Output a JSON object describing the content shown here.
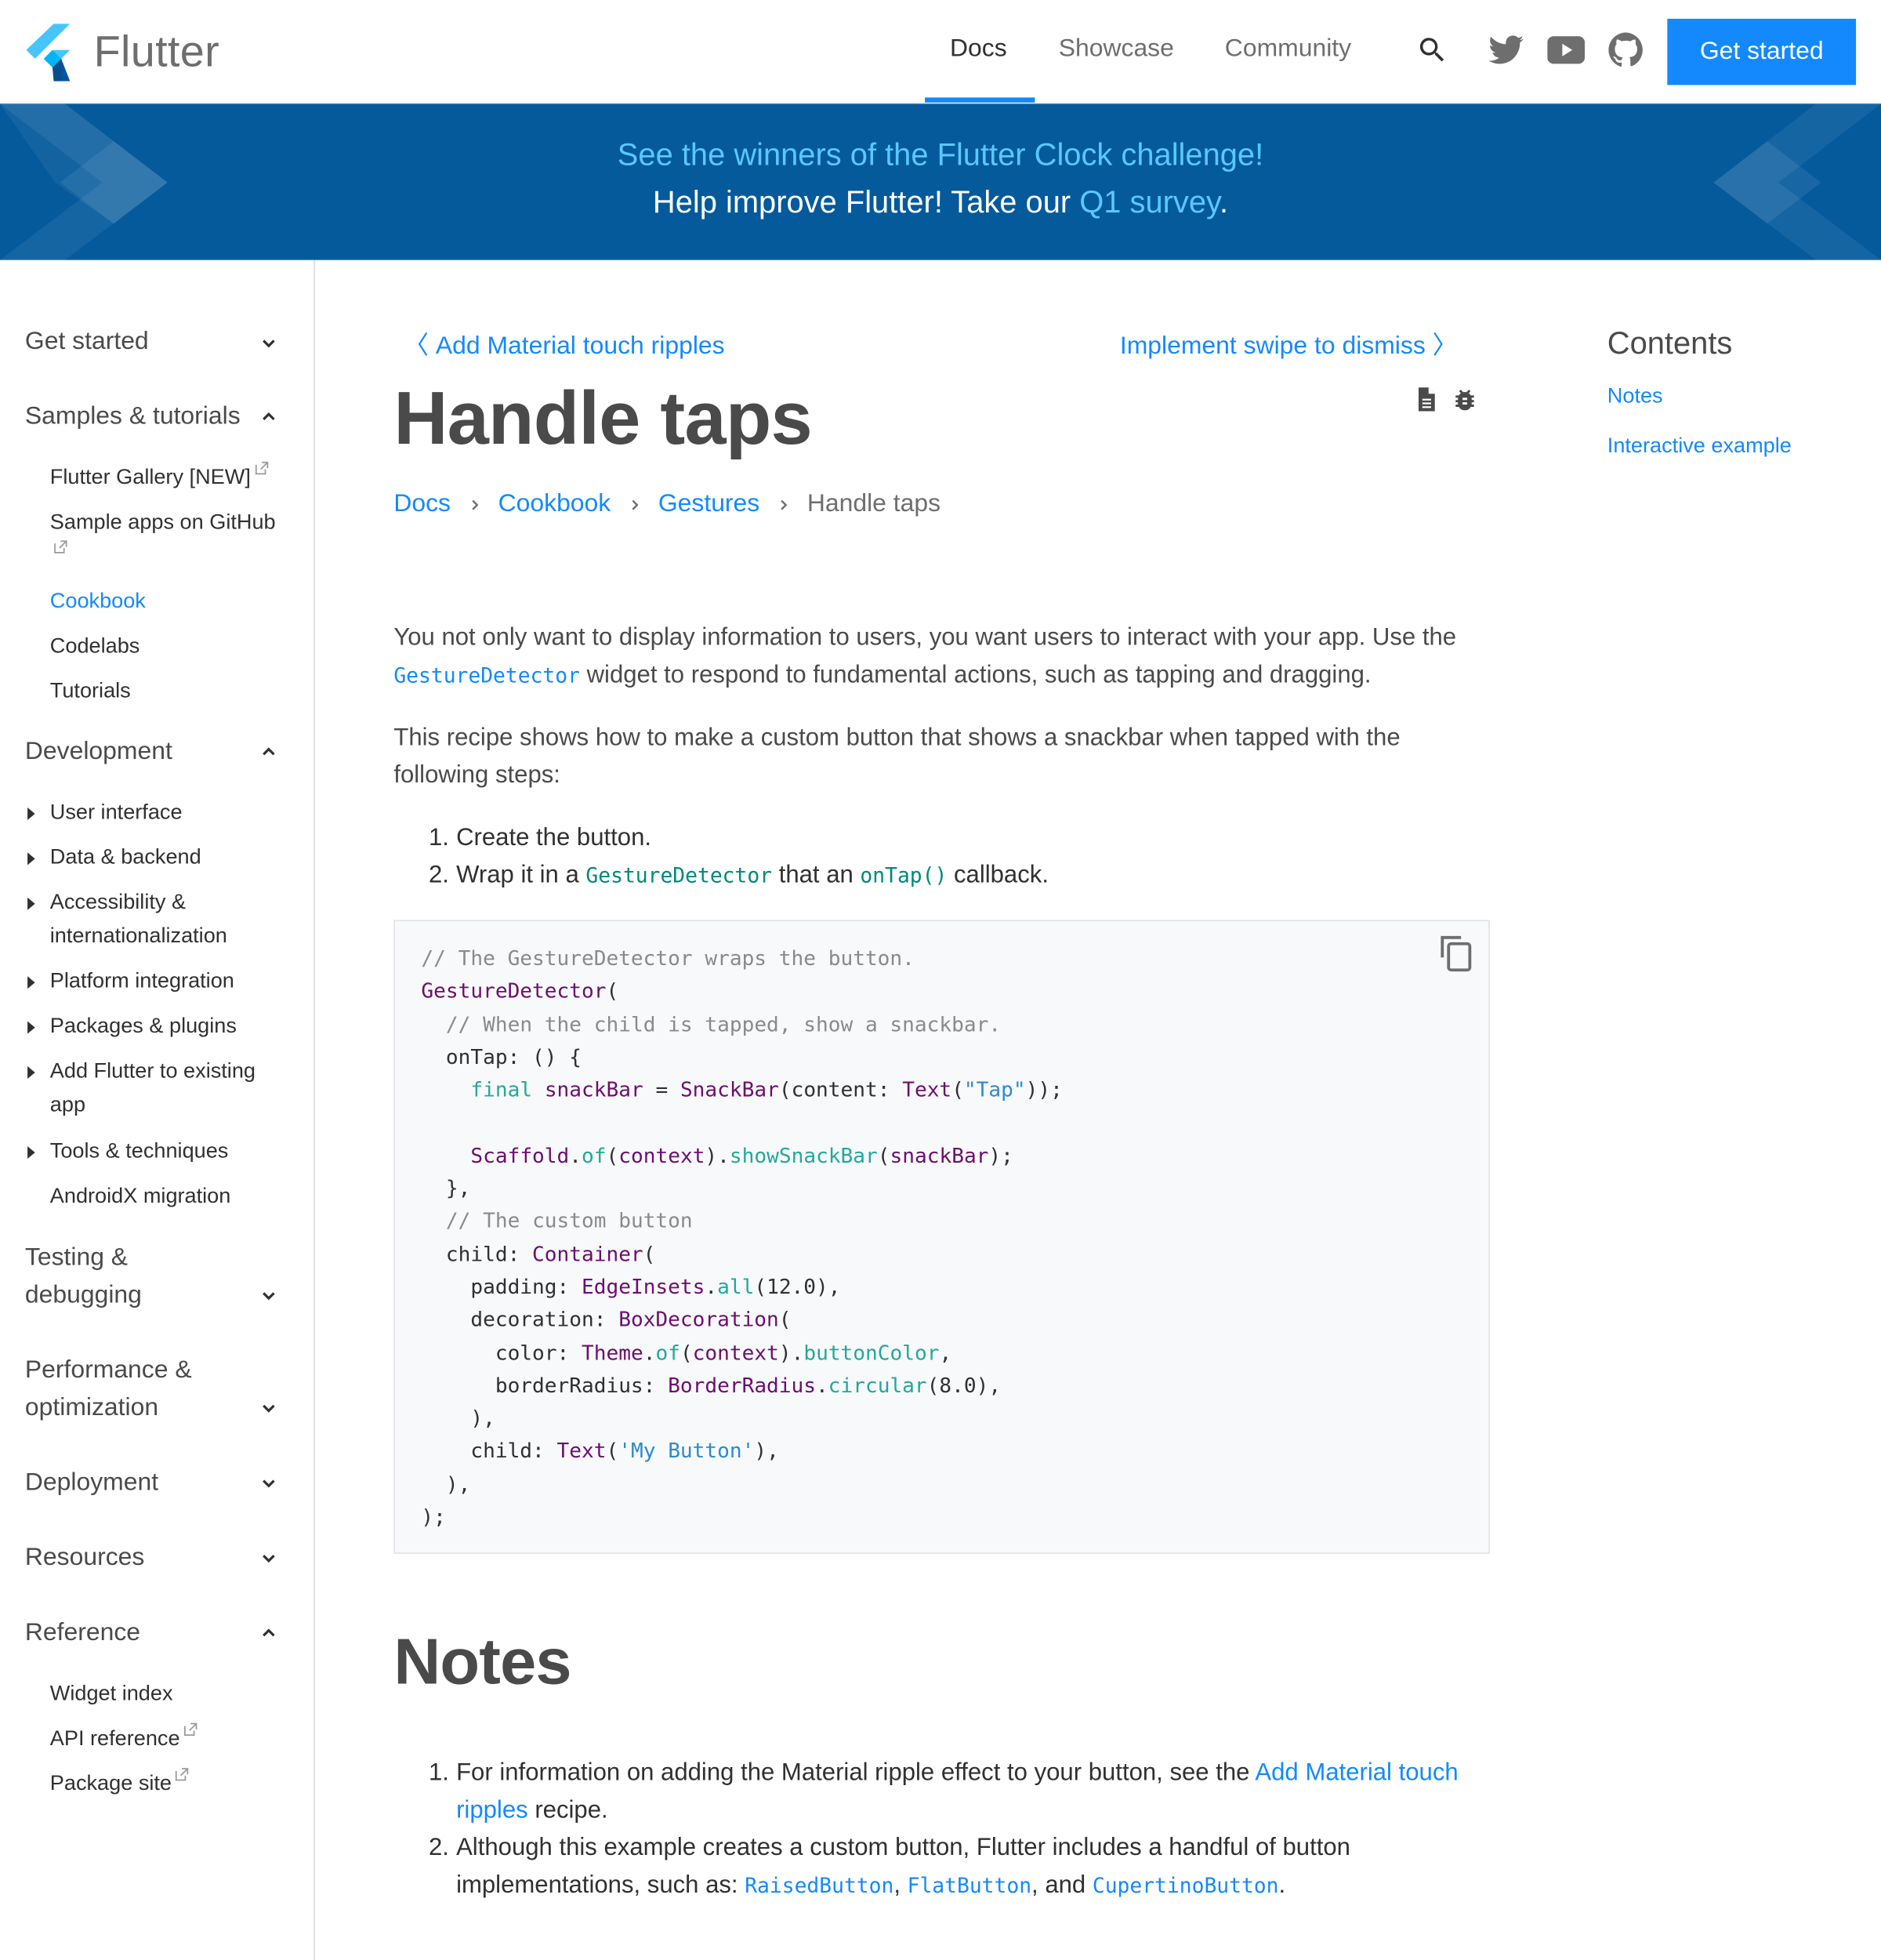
{
  "header": {
    "logo_text": "Flutter",
    "nav": [
      {
        "label": "Docs",
        "active": true
      },
      {
        "label": "Showcase",
        "active": false
      },
      {
        "label": "Community",
        "active": false
      }
    ],
    "icons": [
      "search-icon",
      "twitter-icon",
      "youtube-icon",
      "github-icon"
    ],
    "cta_label": "Get started"
  },
  "banner": {
    "line1": "See the winners of the Flutter Clock challenge!",
    "line2_prefix": "Help improve Flutter! Take our ",
    "line2_link": "Q1 survey",
    "line2_suffix": "."
  },
  "sidebar": {
    "sections": [
      {
        "label": "Get started",
        "expanded": false
      },
      {
        "label": "Samples & tutorials",
        "expanded": true,
        "items": [
          {
            "label": "Flutter Gallery [NEW]",
            "external": true
          },
          {
            "label": "Sample apps on GitHub",
            "external": true
          },
          {
            "label": "Cookbook",
            "active": true
          },
          {
            "label": "Codelabs"
          },
          {
            "label": "Tutorials"
          }
        ]
      },
      {
        "label": "Development",
        "expanded": true,
        "items": [
          {
            "label": "User interface",
            "collapsible": true
          },
          {
            "label": "Data & backend",
            "collapsible": true
          },
          {
            "label": "Accessibility & internationalization",
            "collapsible": true
          },
          {
            "label": "Platform integration",
            "collapsible": true
          },
          {
            "label": "Packages & plugins",
            "collapsible": true
          },
          {
            "label": "Add Flutter to existing app",
            "collapsible": true
          },
          {
            "label": "Tools & techniques",
            "collapsible": true
          },
          {
            "label": "AndroidX migration"
          }
        ]
      },
      {
        "label": "Testing & debugging",
        "expanded": false
      },
      {
        "label": "Performance & optimization",
        "expanded": false
      },
      {
        "label": "Deployment",
        "expanded": false
      },
      {
        "label": "Resources",
        "expanded": false
      },
      {
        "label": "Reference",
        "expanded": true,
        "items": [
          {
            "label": "Widget index"
          },
          {
            "label": "API reference",
            "external": true
          },
          {
            "label": "Package site",
            "external": true
          }
        ]
      }
    ]
  },
  "main": {
    "prev_link": "Add Material touch ripples",
    "next_link": "Implement swipe to dismiss",
    "title": "Handle taps",
    "breadcrumb": [
      "Docs",
      "Cookbook",
      "Gestures",
      "Handle taps"
    ],
    "intro": {
      "p1_a": "You not only want to display information to users, you want users to interact with your app. Use the ",
      "p1_code": "GestureDetector",
      "p1_b": " widget to respond to fundamental actions, such as tapping and dragging.",
      "p2": "This recipe shows how to make a custom button that shows a snackbar when tapped with the following steps:"
    },
    "steps": [
      {
        "num": "1.",
        "text": "Create the button."
      },
      {
        "num": "2.",
        "a": "Wrap it in a ",
        "code1": "GestureDetector",
        "b": " that an ",
        "code2": "onTap()",
        "c": " callback."
      }
    ],
    "code_lines": [
      "// The GestureDetector wraps the button.",
      "GestureDetector(",
      "  // When the child is tapped, show a snackbar.",
      "  onTap: () {",
      "    final snackBar = SnackBar(content: Text(\"Tap\"));",
      "",
      "    Scaffold.of(context).showSnackBar(snackBar);",
      "  },",
      "  // The custom button",
      "  child: Container(",
      "    padding: EdgeInsets.all(12.0),",
      "    decoration: BoxDecoration(",
      "      color: Theme.of(context).buttonColor,",
      "      borderRadius: BorderRadius.circular(8.0),",
      "    ),",
      "    child: Text('My Button'),",
      "  ),",
      ");"
    ],
    "notes_title": "Notes",
    "notes": [
      {
        "num": "1.",
        "a": "For information on adding the Material ripple effect to your button, see the ",
        "link": "Add Material touch ripples",
        "b": " recipe."
      },
      {
        "num": "2.",
        "a": "Although this example creates a custom button, Flutter includes a handful of button implementations, such as: ",
        "code1": "RaisedButton",
        "sep1": ", ",
        "code2": "FlatButton",
        "sep2": ", and ",
        "code3": "CupertinoButton",
        "end": "."
      }
    ]
  },
  "toc": {
    "title": "Contents",
    "items": [
      "Notes",
      "Interactive example"
    ]
  },
  "colors": {
    "accent": "#1389fd",
    "banner_bg": "#055a9c",
    "banner_link": "#5ac8fa",
    "code_bg": "#f8f9fa"
  }
}
